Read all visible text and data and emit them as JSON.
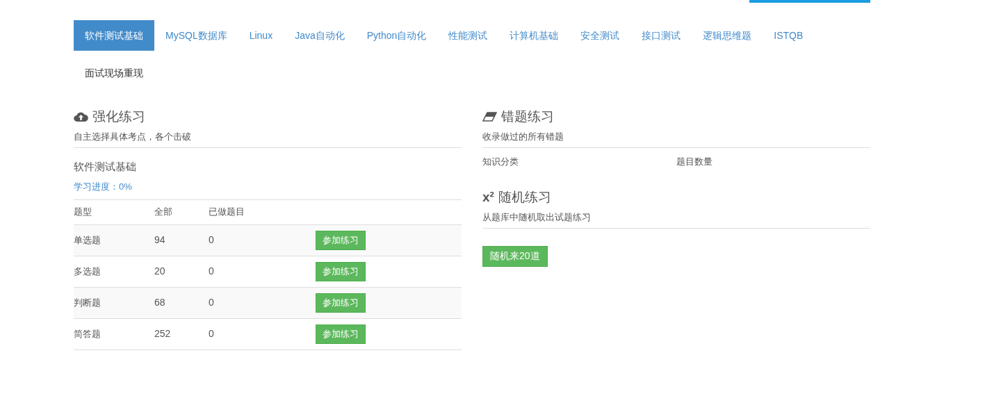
{
  "tabs": [
    {
      "label": "软件测试基础",
      "selected": true
    },
    {
      "label": "MySQL数据库",
      "selected": false
    },
    {
      "label": "Linux",
      "selected": false
    },
    {
      "label": "Java自动化",
      "selected": false
    },
    {
      "label": "Python自动化",
      "selected": false
    },
    {
      "label": "性能测试",
      "selected": false
    },
    {
      "label": "计算机基础",
      "selected": false
    },
    {
      "label": "安全测试",
      "selected": false
    },
    {
      "label": "接口测试",
      "selected": false
    },
    {
      "label": "逻辑思维题",
      "selected": false
    },
    {
      "label": "ISTQB",
      "selected": false
    },
    {
      "label": "面试现场重现",
      "selected": false
    }
  ],
  "practice": {
    "title": "强化练习",
    "subtitle": "自主选择具体考点，各个击破",
    "subject": "软件测试基础",
    "progress": "学习进度：0%",
    "columns": [
      "题型",
      "全部",
      "已做题目"
    ],
    "rows": [
      {
        "type": "单选题",
        "total": "94",
        "done": "0",
        "button": "参加练习"
      },
      {
        "type": "多选题",
        "total": "20",
        "done": "0",
        "button": "参加练习"
      },
      {
        "type": "判断题",
        "total": "68",
        "done": "0",
        "button": "参加练习"
      },
      {
        "type": "简答题",
        "total": "252",
        "done": "0",
        "button": "参加练习"
      }
    ]
  },
  "mistakes": {
    "title": "错题练习",
    "subtitle": "收录做过的所有错题",
    "columns": [
      "知识分类",
      "题目数量"
    ]
  },
  "random": {
    "icon_glyph": "x²",
    "title": "随机练习",
    "subtitle": "从题库中随机取出试题练习",
    "button": "随机来20道"
  }
}
